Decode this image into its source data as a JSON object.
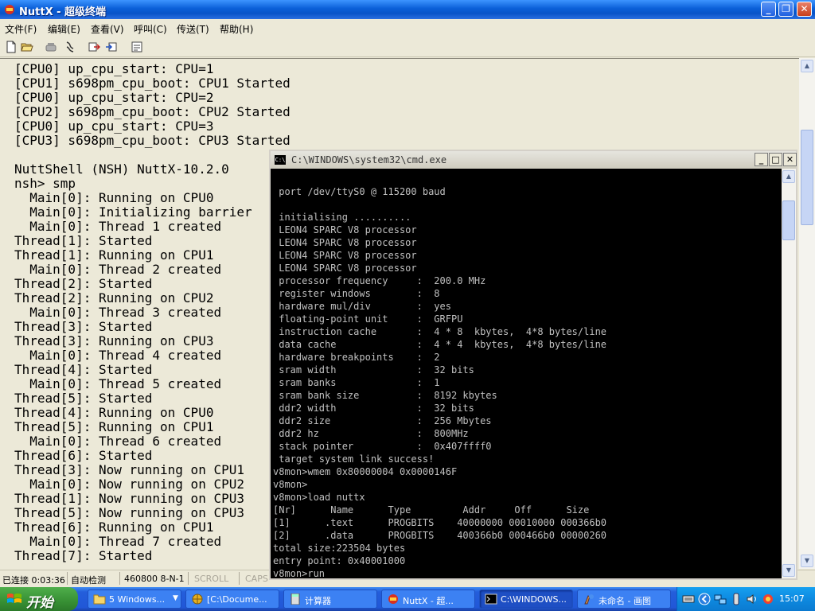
{
  "hyperterminal": {
    "title": "NuttX - 超级终端",
    "menu": [
      "文件(F)",
      "编辑(E)",
      "查看(V)",
      "呼叫(C)",
      "传送(T)",
      "帮助(H)"
    ],
    "terminal_lines": [
      "[CPU0] up_cpu_start: CPU=1",
      "[CPU1] s698pm_cpu_boot: CPU1 Started",
      "[CPU0] up_cpu_start: CPU=2",
      "[CPU2] s698pm_cpu_boot: CPU2 Started",
      "[CPU0] up_cpu_start: CPU=3",
      "[CPU3] s698pm_cpu_boot: CPU3 Started",
      "",
      "NuttShell (NSH) NuttX-10.2.0",
      "nsh> smp",
      "  Main[0]: Running on CPU0",
      "  Main[0]: Initializing barrier",
      "  Main[0]: Thread 1 created",
      "Thread[1]: Started",
      "Thread[1]: Running on CPU1",
      "  Main[0]: Thread 2 created",
      "Thread[2]: Started",
      "Thread[2]: Running on CPU2",
      "  Main[0]: Thread 3 created",
      "Thread[3]: Started",
      "Thread[3]: Running on CPU3",
      "  Main[0]: Thread 4 created",
      "Thread[4]: Started",
      "  Main[0]: Thread 5 created",
      "Thread[5]: Started",
      "Thread[4]: Running on CPU0",
      "Thread[5]: Running on CPU1",
      "  Main[0]: Thread 6 created",
      "Thread[6]: Started",
      "Thread[3]: Now running on CPU1",
      "  Main[0]: Now running on CPU2",
      "Thread[1]: Now running on CPU3",
      "Thread[5]: Now running on CPU3",
      "Thread[6]: Running on CPU1",
      "  Main[0]: Thread 7 created",
      "Thread[7]: Started"
    ],
    "status": {
      "connected": "已连接 0:03:36",
      "detect": "自动检测",
      "port": "460800 8-N-1",
      "scroll": "SCROLL",
      "caps": "CAPS"
    }
  },
  "cmd": {
    "title": "C:\\WINDOWS\\system32\\cmd.exe",
    "lines": [
      " port /dev/ttyS0 @ 115200 baud",
      "",
      " initialising ..........",
      " LEON4 SPARC V8 processor",
      " LEON4 SPARC V8 processor",
      " LEON4 SPARC V8 processor",
      " LEON4 SPARC V8 processor",
      " processor frequency     :  200.0 MHz",
      " register windows        :  8",
      " hardware mul/div        :  yes",
      " floating-point unit     :  GRFPU",
      " instruction cache       :  4 * 8  kbytes,  4*8 bytes/line",
      " data cache              :  4 * 4  kbytes,  4*8 bytes/line",
      " hardware breakpoints    :  2",
      " sram width              :  32 bits",
      " sram banks              :  1",
      " sram bank size          :  8192 kbytes",
      " ddr2 width              :  32 bits",
      " ddr2 size               :  256 Mbytes",
      " ddr2 hz                 :  800MHz",
      " stack pointer           :  0x407ffff0",
      " target system link success!",
      "v8mon>wmem 0x80000004 0x0000146F",
      "v8mon>",
      "v8mon>load nuttx",
      "[Nr]      Name      Type         Addr     Off      Size",
      "[1]      .text      PROGBITS    40000000 00010000 000366b0",
      "[2]      .data      PROGBITS    400366b0 000466b0 00000260",
      "total size:223504 bytes",
      "entry point: 0x40001000",
      "v8mon>run"
    ]
  },
  "taskbar": {
    "start_label": "开始",
    "tasks": [
      {
        "label": "5 Windows...",
        "icon": "folder-icon"
      },
      {
        "label": "[C:\\Docume...",
        "icon": "browser-icon"
      },
      {
        "label": "计算器",
        "icon": "calculator-icon"
      },
      {
        "label": "NuttX - 超...",
        "icon": "hyperterminal-icon"
      },
      {
        "label": "C:\\WINDOWS...",
        "icon": "cmd-icon"
      },
      {
        "label": "未命名 - 画图",
        "icon": "paint-icon"
      }
    ],
    "clock": "15:07"
  },
  "colors": {
    "terminal_bg": "#ece9d8",
    "cmd_bg": "#000000",
    "cmd_text": "#c0c0c0",
    "xp_blue": "#245edb",
    "start_green": "#379034"
  }
}
